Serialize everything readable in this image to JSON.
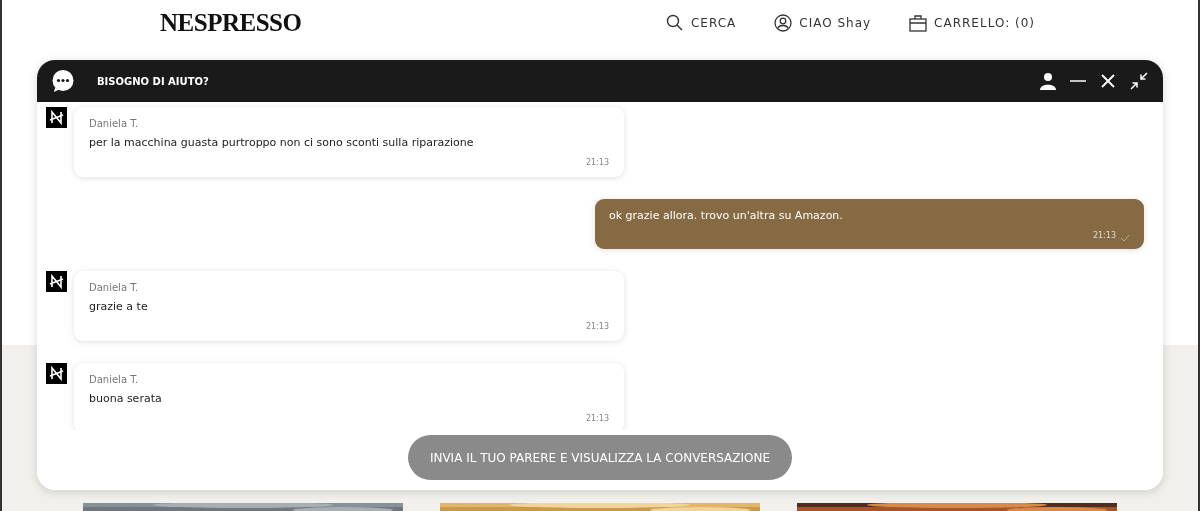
{
  "site_header": {
    "logo": "NESPRESSO",
    "nav": [
      {
        "kind": "search",
        "label": "CERCA"
      },
      {
        "kind": "account",
        "label": "CIAO Shay"
      },
      {
        "kind": "cart",
        "label": "CARRELLO: (0)"
      }
    ]
  },
  "chat": {
    "title": "BISOGNO DI AIUTO?",
    "messages": [
      {
        "kind": "agent",
        "sender": "Daniela T.",
        "text": "per la macchina guasta purtroppo non ci sono sconti sulla riparazione",
        "time": "21:13"
      },
      {
        "kind": "user",
        "text": "ok grazie allora. trovo un'altra su Amazon.",
        "time": "21:13",
        "read": true
      },
      {
        "kind": "agent",
        "sender": "Daniela T.",
        "text": "grazie a te",
        "time": "21:13"
      },
      {
        "kind": "agent",
        "sender": "Daniela T.",
        "text": "buona serata",
        "time": "21:13"
      }
    ],
    "feedback_button": "INVIA IL TUO PARERE E VISUALIZZA LA CONVERSAZIONE"
  }
}
